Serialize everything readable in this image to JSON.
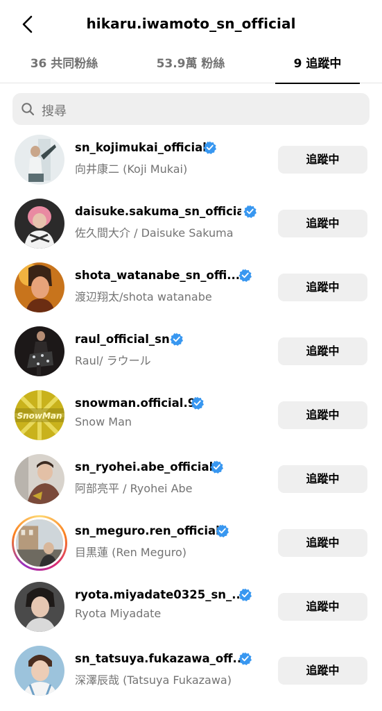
{
  "header": {
    "title": "hikaru.iwamoto_sn_official"
  },
  "tabs": [
    {
      "label": "36 共同粉絲"
    },
    {
      "label": "53.9萬 粉絲"
    },
    {
      "label": "9 追蹤中"
    }
  ],
  "search": {
    "placeholder": "搜尋"
  },
  "following_button_label": "追蹤中",
  "accounts": [
    {
      "username": "sn_kojimukai_official",
      "name": "向井康二 (Koji Mukai)",
      "verified": true
    },
    {
      "username": "daisuke.sakuma_sn_official",
      "name": "佐久間大介 / Daisuke Sakuma",
      "verified": true
    },
    {
      "username": "shota_watanabe_sn_offi...",
      "name": "渡辺翔太/shota watanabe",
      "verified": true
    },
    {
      "username": "raul_official_sn",
      "name": "Raul/ ラウール",
      "verified": true
    },
    {
      "username": "snowman.official.9",
      "name": "Snow Man",
      "verified": true
    },
    {
      "username": "sn_ryohei.abe_official",
      "name": "阿部亮平 / Ryohei Abe",
      "verified": true
    },
    {
      "username": "sn_meguro.ren_official",
      "name": "目黒蓮 (Ren Meguro)",
      "verified": true
    },
    {
      "username": "ryota.miyadate0325_sn_...",
      "name": "Ryota Miyadate",
      "verified": true
    },
    {
      "username": "sn_tatsuya.fukazawa_off...",
      "name": "深澤辰哉 (Tatsuya Fukazawa)",
      "verified": true
    }
  ],
  "avatar_logo_text": "SnowMan",
  "colors": {
    "verified": "#3897f0",
    "secondary_text": "#737373",
    "button_bg": "#efefef"
  }
}
